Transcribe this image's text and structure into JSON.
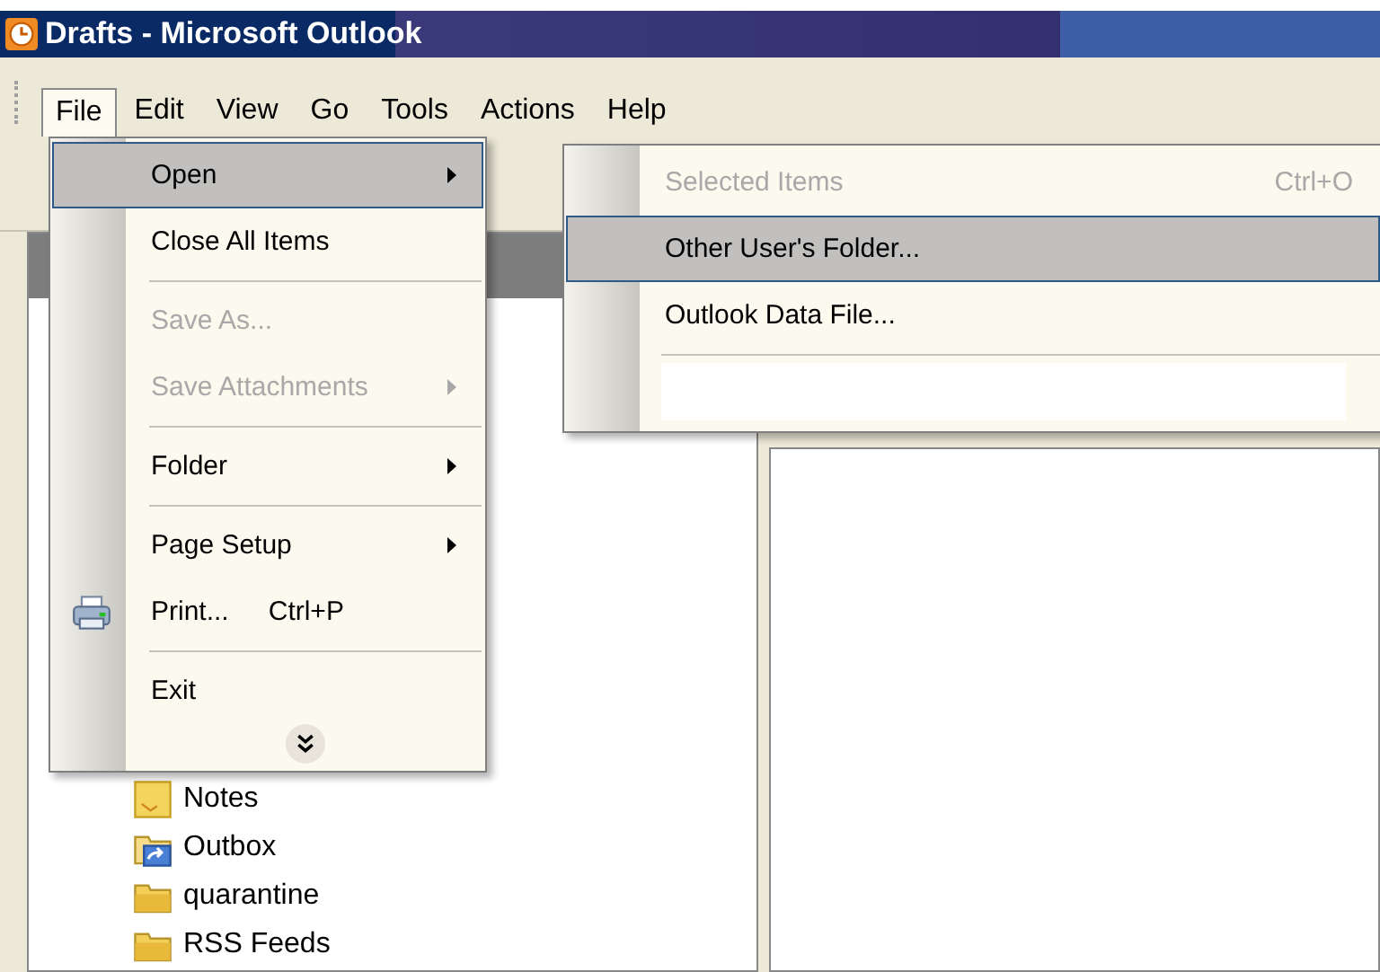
{
  "window": {
    "title": "Drafts - Microsoft Outlook"
  },
  "menu_bar": [
    {
      "label": "File",
      "selected": true
    },
    {
      "label": "Edit",
      "selected": false
    },
    {
      "label": "View",
      "selected": false
    },
    {
      "label": "Go",
      "selected": false
    },
    {
      "label": "Tools",
      "selected": false
    },
    {
      "label": "Actions",
      "selected": false
    },
    {
      "label": "Help",
      "selected": false
    }
  ],
  "file_menu": {
    "items": [
      {
        "label": "Open",
        "submenu": true,
        "selected": true,
        "disabled": false,
        "separator_before": false
      },
      {
        "label": "Close All Items",
        "submenu": false,
        "selected": false,
        "disabled": false,
        "separator_before": false
      },
      {
        "label": "Save As...",
        "submenu": false,
        "selected": false,
        "disabled": true,
        "separator_before": true
      },
      {
        "label": "Save Attachments",
        "submenu": true,
        "selected": false,
        "disabled": true,
        "separator_before": false
      },
      {
        "label": "Folder",
        "submenu": true,
        "selected": false,
        "disabled": false,
        "separator_before": true
      },
      {
        "label": "Page Setup",
        "submenu": true,
        "selected": false,
        "disabled": false,
        "separator_before": true
      },
      {
        "label": "Print...",
        "shortcut": "Ctrl+P",
        "kind": "printer",
        "submenu": false,
        "selected": false,
        "disabled": false,
        "separator_before": false
      },
      {
        "label": "Exit",
        "submenu": false,
        "selected": false,
        "disabled": false,
        "separator_before": true
      }
    ],
    "expand_more": true
  },
  "open_submenu": {
    "items": [
      {
        "label": "Selected Items",
        "shortcut": "Ctrl+O",
        "selected": false,
        "disabled": true
      },
      {
        "label": "Other User's Folder...",
        "selected": true,
        "disabled": false
      },
      {
        "label": "Outlook Data File...",
        "selected": false,
        "disabled": false
      }
    ],
    "blank_row": true
  },
  "folders": [
    {
      "name": "Notes",
      "kind": "notes"
    },
    {
      "name": "Outbox",
      "kind": "outbox"
    },
    {
      "name": "quarantine",
      "kind": "folder"
    },
    {
      "name": "RSS Feeds",
      "kind": "folder"
    }
  ]
}
